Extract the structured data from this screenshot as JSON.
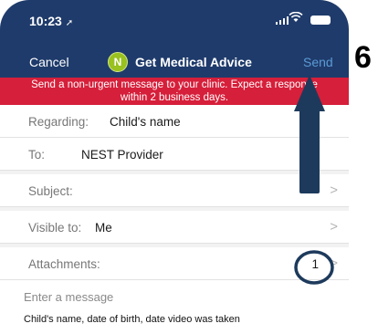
{
  "status_bar": {
    "time": "10:23",
    "location_arrow": "location-arrow-icon"
  },
  "nav": {
    "cancel_label": "Cancel",
    "avatar_initial": "N",
    "title": "Get Medical Advice",
    "send_label": "Send"
  },
  "notice": {
    "line1": "Send a non-urgent message to your clinic. Expect a response",
    "line2": "within 2 business days."
  },
  "form": {
    "regarding": {
      "label": "Regarding:",
      "value": "Child's name"
    },
    "to": {
      "label": "To:",
      "value": "NEST Provider"
    },
    "subject": {
      "label": "Subject:"
    },
    "visible_to": {
      "label": "Visible to:",
      "value": "Me"
    },
    "attachments": {
      "label": "Attachments:",
      "count": "1"
    }
  },
  "message": {
    "placeholder": "Enter a message",
    "body": "Child's name, date of birth, date video was taken"
  },
  "annotation": {
    "step_number": "6"
  },
  "colors": {
    "header": "#1f3b6b",
    "notice": "#d61f3a",
    "send": "#5b9bd5",
    "avatar": "#99c11f",
    "annotation": "#1d3a5c"
  }
}
